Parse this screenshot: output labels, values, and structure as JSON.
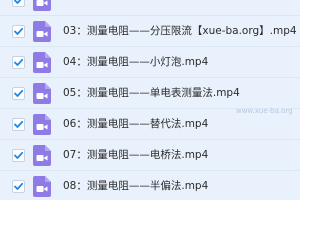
{
  "rows": [
    {
      "name": "",
      "checked": true
    },
    {
      "name": "03：测量电阻——分压限流【xue-ba.org】.mp4",
      "checked": true
    },
    {
      "name": "04：测量电阻——小灯泡.mp4",
      "checked": true
    },
    {
      "name": "05：测量电阻——单电表测量法.mp4",
      "checked": true
    },
    {
      "name": "06：测量电阻——替代法.mp4",
      "checked": true
    },
    {
      "name": "07：测量电阻——电桥法.mp4",
      "checked": true
    },
    {
      "name": "08：测量电阻——半偏法.mp4",
      "checked": true
    }
  ],
  "watermark": "www.xue-ba.org",
  "colors": {
    "row_bg": "#e9f1fc",
    "checkbox_check": "#1e86e6",
    "video_icon": "#8e7be6"
  },
  "icons": {
    "checkbox": "checkmark-icon",
    "file": "video-file-icon"
  }
}
